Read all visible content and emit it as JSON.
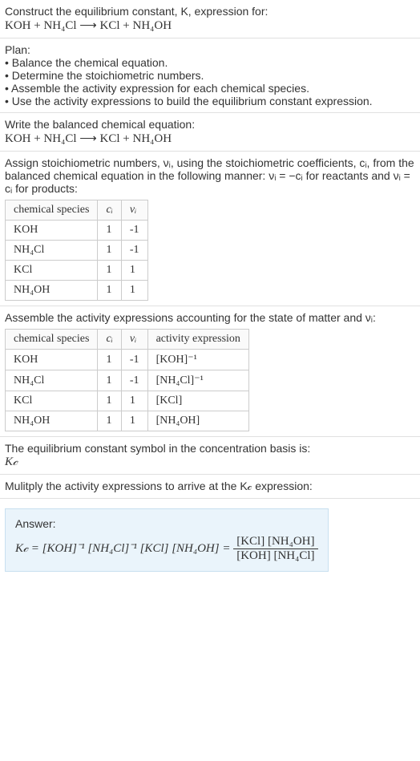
{
  "header": {
    "prompt_line1": "Construct the equilibrium constant, K, expression for:",
    "equation": "KOH + NH₄Cl ⟶ KCl + NH₄OH"
  },
  "plan": {
    "title": "Plan:",
    "items": [
      "• Balance the chemical equation.",
      "• Determine the stoichiometric numbers.",
      "• Assemble the activity expression for each chemical species.",
      "• Use the activity expressions to build the equilibrium constant expression."
    ]
  },
  "balanced": {
    "title": "Write the balanced chemical equation:",
    "equation": "KOH + NH₄Cl ⟶ KCl + NH₄OH"
  },
  "stoich": {
    "intro": "Assign stoichiometric numbers, νᵢ, using the stoichiometric coefficients, cᵢ, from the balanced chemical equation in the following manner: νᵢ = −cᵢ for reactants and νᵢ = cᵢ for products:",
    "headers": {
      "species": "chemical species",
      "ci": "cᵢ",
      "vi": "νᵢ"
    },
    "rows": [
      {
        "species": "KOH",
        "ci": "1",
        "vi": "-1"
      },
      {
        "species": "NH₄Cl",
        "ci": "1",
        "vi": "-1"
      },
      {
        "species": "KCl",
        "ci": "1",
        "vi": "1"
      },
      {
        "species": "NH₄OH",
        "ci": "1",
        "vi": "1"
      }
    ]
  },
  "activity": {
    "intro": "Assemble the activity expressions accounting for the state of matter and νᵢ:",
    "headers": {
      "species": "chemical species",
      "ci": "cᵢ",
      "vi": "νᵢ",
      "expr": "activity expression"
    },
    "rows": [
      {
        "species": "KOH",
        "ci": "1",
        "vi": "-1",
        "expr": "[KOH]⁻¹"
      },
      {
        "species": "NH₄Cl",
        "ci": "1",
        "vi": "-1",
        "expr": "[NH₄Cl]⁻¹"
      },
      {
        "species": "KCl",
        "ci": "1",
        "vi": "1",
        "expr": "[KCl]"
      },
      {
        "species": "NH₄OH",
        "ci": "1",
        "vi": "1",
        "expr": "[NH₄OH]"
      }
    ]
  },
  "symbol": {
    "line1": "The equilibrium constant symbol in the concentration basis is:",
    "line2": "K𝒸"
  },
  "multiply": {
    "text": "Mulitply the activity expressions to arrive at the K𝒸 expression:"
  },
  "answer": {
    "label": "Answer:",
    "lhs": "K𝒸 = [KOH]⁻¹ [NH₄Cl]⁻¹ [KCl] [NH₄OH] = ",
    "frac_num": "[KCl] [NH₄OH]",
    "frac_den": "[KOH] [NH₄Cl]"
  }
}
